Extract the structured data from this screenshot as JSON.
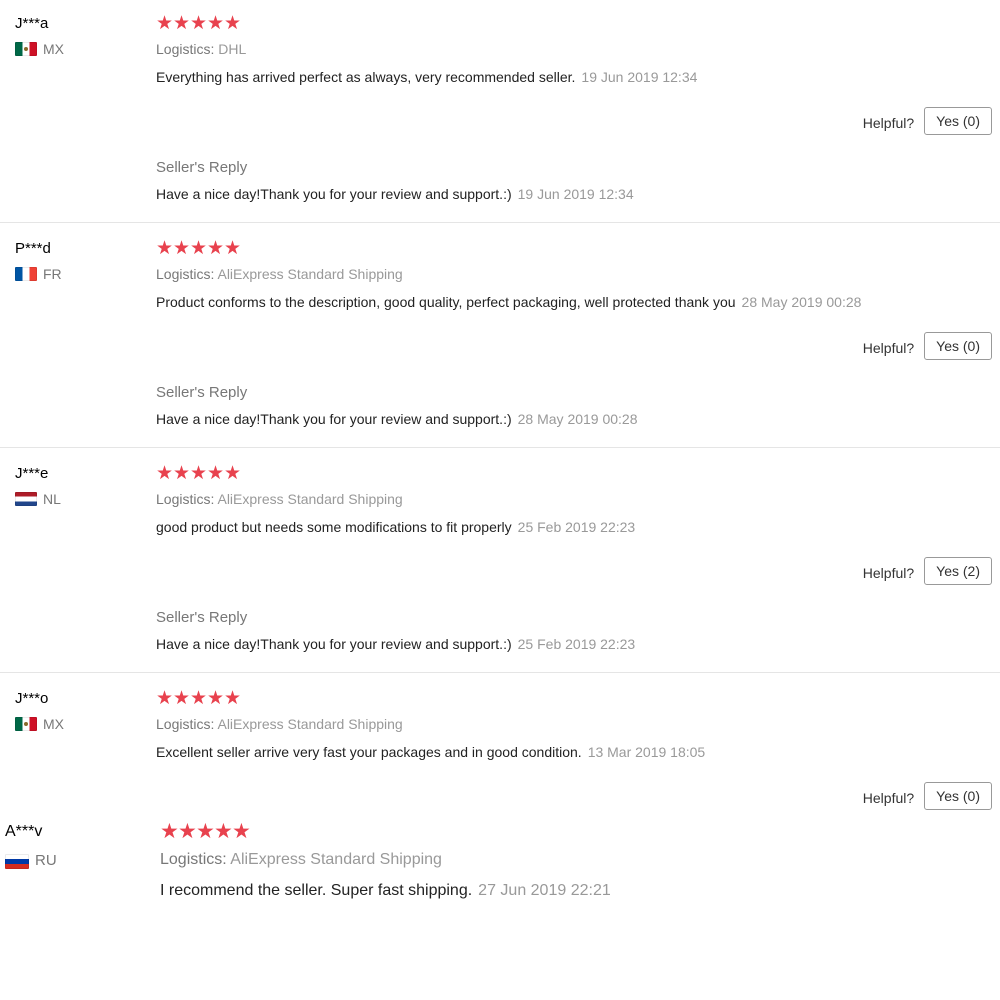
{
  "helpful_label": "Helpful?",
  "logistics_label": "Logistics:",
  "seller_reply_label": "Seller's Reply",
  "star_glyph": "★",
  "reviews": [
    {
      "buyer": "J***a",
      "country": "MX",
      "rating": 5,
      "logistics": "DHL",
      "feedback": "Everything has arrived perfect as always, very recommended seller.",
      "date": "19 Jun 2019 12:34",
      "helpful_button": "Yes (0)",
      "reply": "Have a nice day!Thank you for your review and support.:)",
      "reply_date": "19 Jun 2019 12:34"
    },
    {
      "buyer": "P***d",
      "country": "FR",
      "rating": 5,
      "logistics": "AliExpress Standard Shipping",
      "feedback": "Product conforms to the description, good quality, perfect packaging, well protected thank you",
      "date": "28 May 2019 00:28",
      "helpful_button": "Yes (0)",
      "reply": "Have a nice day!Thank you for your review and support.:)",
      "reply_date": "28 May 2019 00:28"
    },
    {
      "buyer": "J***e",
      "country": "NL",
      "rating": 5,
      "logistics": "AliExpress Standard Shipping",
      "feedback": "good product but needs some modifications to fit properly",
      "date": "25 Feb 2019 22:23",
      "helpful_button": "Yes (2)",
      "reply": "Have a nice day!Thank you for your review and support.:)",
      "reply_date": "25 Feb 2019 22:23"
    },
    {
      "buyer": "J***o",
      "country": "MX",
      "rating": 5,
      "logistics": "AliExpress Standard Shipping",
      "feedback": "Excellent seller arrive very fast your packages and in good condition.",
      "date": "13 Mar 2019 18:05",
      "helpful_button": "Yes (0)"
    },
    {
      "buyer": "A***v",
      "country": "RU",
      "rating": 5,
      "logistics": "AliExpress Standard Shipping",
      "feedback": "I recommend the seller. Super fast shipping.",
      "date": "27 Jun 2019 22:21"
    }
  ]
}
